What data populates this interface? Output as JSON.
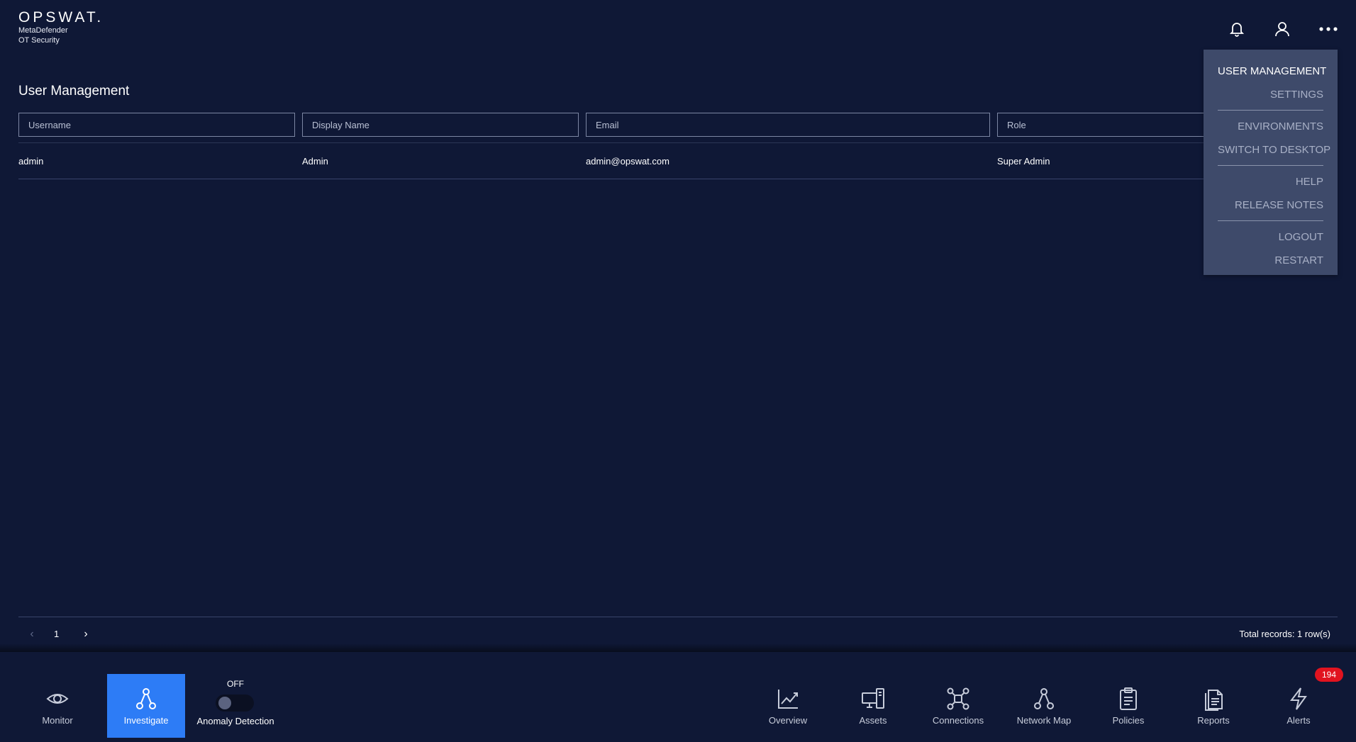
{
  "brand": {
    "wordmark": "OPSWAT.",
    "product_line1": "MetaDefender",
    "product_line2": "OT Security"
  },
  "header_icons": [
    "bell-icon",
    "user-icon",
    "more-dots-icon"
  ],
  "menu": {
    "items": [
      {
        "label": "USER MANAGEMENT",
        "active": true
      },
      {
        "label": "SETTINGS"
      },
      {
        "label": "ENVIRONMENTS"
      },
      {
        "label": "SWITCH TO DESKTOP"
      },
      {
        "label": "HELP"
      },
      {
        "label": "RELEASE NOTES"
      },
      {
        "label": "LOGOUT"
      },
      {
        "label": "RESTART"
      }
    ]
  },
  "page": {
    "title": "User Management"
  },
  "filters": {
    "username_placeholder": "Username",
    "display_name_placeholder": "Display Name",
    "email_placeholder": "Email",
    "role_placeholder": "Role"
  },
  "table": {
    "rows": [
      {
        "username": "admin",
        "display_name": "Admin",
        "email": "admin@opswat.com",
        "role": "Super Admin"
      }
    ]
  },
  "pager": {
    "prev": "‹",
    "current_page": "1",
    "next": "›",
    "total_records": "Total records: 1 row(s)"
  },
  "bottom_nav": {
    "monitor": "Monitor",
    "investigate": "Investigate",
    "anomaly_state": "OFF",
    "anomaly_label": "Anomaly Detection",
    "overview": "Overview",
    "assets": "Assets",
    "connections": "Connections",
    "network_map": "Network Map",
    "policies": "Policies",
    "reports": "Reports",
    "alerts": "Alerts",
    "alerts_badge": "194"
  },
  "colors": {
    "background": "#0f1836",
    "menu_bg": "#3e4a6a",
    "active_nav": "#2d7cf6",
    "badge": "#e1131f"
  }
}
